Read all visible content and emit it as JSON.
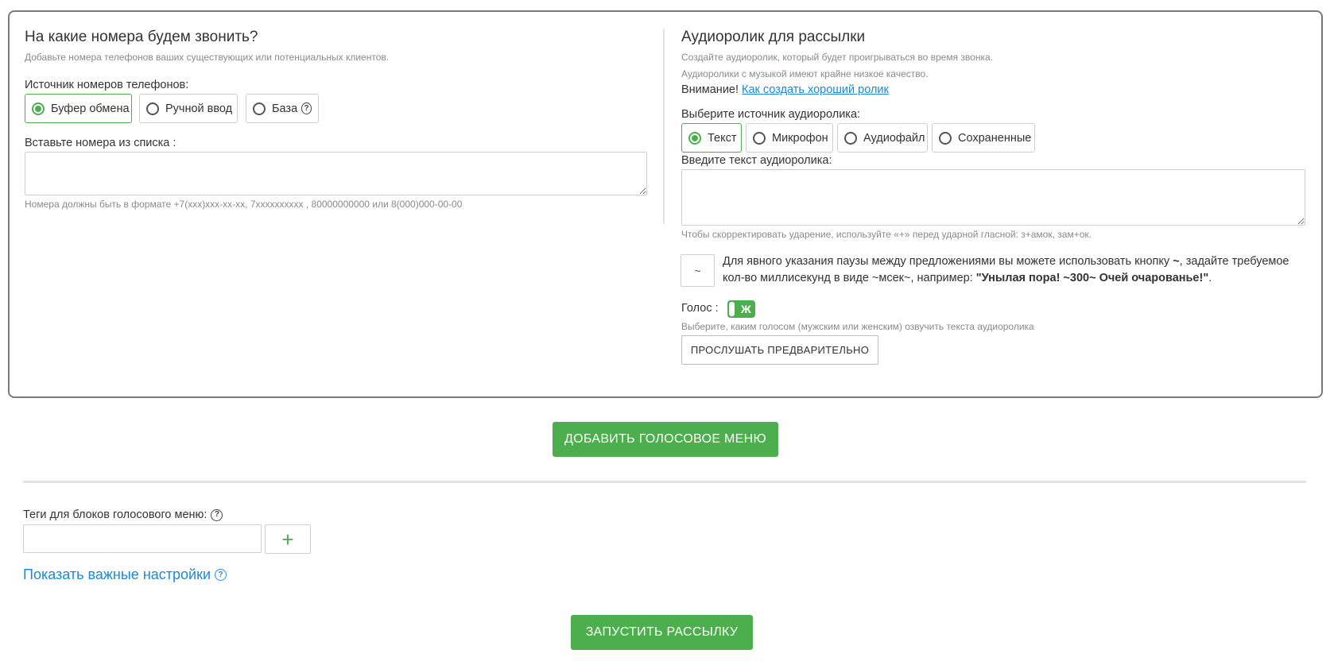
{
  "numbers": {
    "title": "На какие номера будем звонить?",
    "subtitle": "Добавьте номера телефонов ваших существующих или потенциальных клиентов.",
    "source_label": "Источник номеров телефонов:",
    "sources": [
      {
        "label": "Буфер обмена",
        "checked": true
      },
      {
        "label": "Ручной ввод",
        "checked": false
      },
      {
        "label": "База",
        "checked": false
      }
    ],
    "paste_label": "Вставьте номера из списка :",
    "paste_value": "",
    "format_hint": "Номера должны быть в формате +7(xxx)xxx-xx-xx, 7xxxxxxxxxx , 80000000000 или 8(000)000-00-00"
  },
  "audio": {
    "title": "Аудиоролик для рассылки",
    "hint1": "Создайте аудиоролик, который будет проигрываться во время звонка.",
    "hint2": "Аудиоролики с музыкой имеют крайне низкое качество.",
    "attention": "Внимание!",
    "attention_link": "Как создать хороший ролик",
    "source_label": "Выберите источник аудиоролика:",
    "sources": [
      {
        "label": "Текст",
        "checked": true
      },
      {
        "label": "Микрофон",
        "checked": false
      },
      {
        "label": "Аудиофайл",
        "checked": false
      },
      {
        "label": "Сохраненные",
        "checked": false
      }
    ],
    "text_label": "Введите текст аудиоролика:",
    "text_value": "",
    "stress_hint": "Чтобы скорректировать ударение, используйте «+» перед ударной гласной: з+амок, зам+ок.",
    "tilde_button": "~",
    "pause_text_1": "Для явного указания паузы между предложениями вы можете использовать кнопку ",
    "pause_text_tilde": "~",
    "pause_text_2": ", задайте требуемое кол-во миллисекунд в виде ~мсек~, например: ",
    "pause_example": "\"Унылая пора! ~300~ Очей очарованье!\"",
    "pause_text_3": ".",
    "voice_label": "Голос :",
    "voice_value": "Ж",
    "voice_hint": "Выберите, каким голосом (мужским или женским) озвучить текста аудиоролика",
    "preview_button": "ПРОСЛУШАТЬ ПРЕДВАРИТЕЛЬНО"
  },
  "add_menu_button": "ДОБАВИТЬ ГОЛОСОВОЕ МЕНЮ",
  "tags": {
    "label": "Теги для блоков голосового меню:",
    "value": "",
    "add_button": "+"
  },
  "settings_link": "Показать важные настройки",
  "launch_button": "ЗАПУСТИТЬ РАССЫЛКУ",
  "help_glyph": "?",
  "colors": {
    "accent": "#4cae4c",
    "link": "#1a8ad4"
  }
}
